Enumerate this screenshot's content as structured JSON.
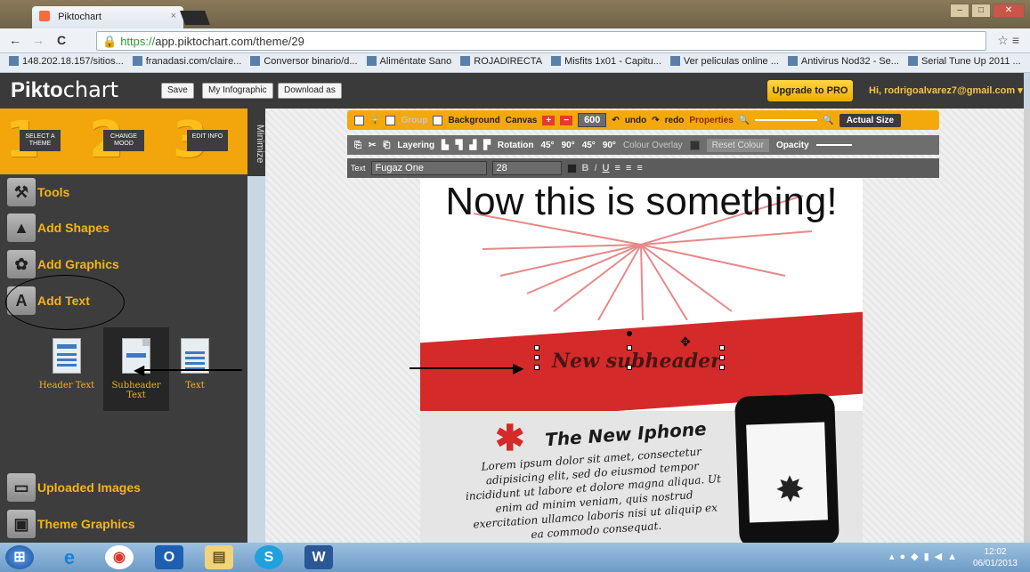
{
  "browser": {
    "tab_title": "Piktochart",
    "tab_close": "×",
    "url_scheme": "https://",
    "url_rest": "app.piktochart.com/theme/29",
    "nav_back": "←",
    "nav_forward": "→",
    "nav_reload": "C",
    "bookmarks": [
      "148.202.18.157/sitios...",
      "franadasi.com/claire...",
      "Conversor binario/d...",
      "Aliméntate Sano",
      "ROJADIRECTA",
      "Misfits 1x01 - Capitu...",
      "Ver peliculas online ...",
      "Antivirus Nod32 - Se...",
      "Serial Tune Up 2011 ..."
    ]
  },
  "app": {
    "logo_bold": "Pikto",
    "logo_light": "chart",
    "save": "Save",
    "my_infographic": "My Infographic",
    "download_as": "Download as",
    "upgrade": "Upgrade to PRO",
    "user": "Hi, rodrigoalvarez7@gmail.com ▾"
  },
  "steps": [
    {
      "num": "1",
      "label": "SELECT A THEME"
    },
    {
      "num": "2",
      "label": "CHANGE MOOD"
    },
    {
      "num": "3",
      "label": "EDIT INFO"
    }
  ],
  "minimize": "Minimize",
  "sidebar": {
    "tools": "Tools",
    "add_shapes": "Add Shapes",
    "add_graphics": "Add Graphics",
    "add_text": "Add Text",
    "uploaded_images": "Uploaded Images",
    "theme_graphics": "Theme Graphics",
    "text_types": [
      "Header Text",
      "Subheader Text",
      "Text"
    ]
  },
  "toolbar": {
    "group": "Group",
    "background": "Background",
    "canvas": "Canvas",
    "plus": "+",
    "minus": "−",
    "canvas_size": "600",
    "undo": "undo",
    "redo": "redo",
    "properties": "Properties",
    "actual_size": "Actual Size",
    "layering": "Layering",
    "rotation": "Rotation",
    "rot_1": "45°",
    "rot_2": "90°",
    "rot_3": "45°",
    "rot_4": "90°",
    "colour_overlay": "Colour Overlay",
    "reset_colour": "Reset Colour",
    "opacity": "Opacity",
    "text_label": "Text",
    "font": "Fugaz One",
    "font_size": "28",
    "bold": "B",
    "italic": "I",
    "underline": "U"
  },
  "infographic": {
    "headline": "Now this is something!",
    "subheader": "New subheader",
    "product_title": "The New Iphone",
    "body": "Lorem ipsum dolor sit amet, consectetur adipisicing elit, sed do eiusmod tempor incididunt ut labore et dolore magna aliqua. Ut enim ad minim veniam, quis nostrud exercitation ullamco laboris nisi ut aliquip ex ea commodo consequat."
  },
  "taskbar": {
    "time": "12:02",
    "date": "06/01/2013"
  },
  "colors": {
    "accent": "#f3a80c",
    "band_red": "#d42a2a",
    "sidebar_bg": "#3d3d3d"
  }
}
